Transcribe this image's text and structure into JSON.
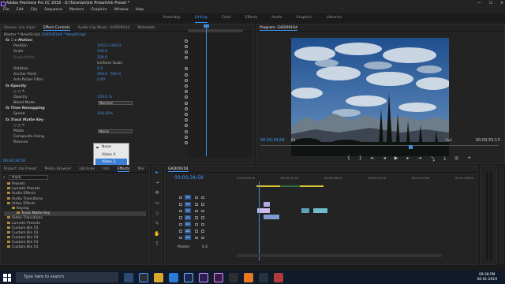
{
  "title": "Adobe Premiere Pro CC 2018 - G:\\Tutorials\\Ink PresetUnk Preset *",
  "window_controls": [
    "—",
    "☐",
    "✕"
  ],
  "menu": [
    "File",
    "Edit",
    "Clip",
    "Sequence",
    "Markers",
    "Graphics",
    "Window",
    "Help"
  ],
  "workspaces": [
    "Assembly",
    "Editing",
    "Color",
    "Effects",
    "Audio",
    "Graphics",
    "Libraries"
  ],
  "active_workspace": "Editing",
  "effect_controls": {
    "tabs": [
      "Source: (no clips)",
      "Effect Controls",
      "Audio Clip Mixer: GADO9104",
      "Metadata"
    ],
    "master": "Master * New/Script",
    "sequence": "GADO9104 * New/Script",
    "ruler_start": "00:34:00",
    "ruler_end": "00:34:58",
    "timecode": "00;00;34;58",
    "rows": [
      {
        "label": "fx  ☐ ▸  Motion",
        "type": "fx",
        "indent": 4
      },
      {
        "label": "Position",
        "v1": "1052.0",
        "v2": "360.0",
        "indent": 14
      },
      {
        "label": "Scale",
        "v1": "100.0",
        "indent": 14
      },
      {
        "label": "Scale Width",
        "v1": "100.0",
        "indent": 14,
        "dim": true
      },
      {
        "label": "",
        "check": "Uniform Scale",
        "indent": 14
      },
      {
        "label": "Rotation",
        "v1": "0.0",
        "indent": 14
      },
      {
        "label": "Anchor Point",
        "v1": "960.0",
        "v2": "540.0",
        "indent": 14
      },
      {
        "label": "Anti-flicker Filter",
        "v1": "0.00",
        "indent": 14
      },
      {
        "label": "fx  Opacity",
        "type": "fx",
        "indent": 4
      },
      {
        "label": "○ ◻ ✎",
        "indent": 14
      },
      {
        "label": "Opacity",
        "v1": "100.0 %",
        "indent": 14
      },
      {
        "label": "Blend Mode",
        "select": "Normal",
        "indent": 14
      },
      {
        "label": "fx  Time Remapping",
        "type": "fx",
        "indent": 4
      },
      {
        "label": "Speed",
        "v1": "100.00%",
        "indent": 14
      },
      {
        "label": "fx  Track Matte Key",
        "type": "fx",
        "indent": 4
      },
      {
        "label": "○ ◻ ✎",
        "indent": 14
      },
      {
        "label": "Matte",
        "select": "None",
        "indent": 14
      },
      {
        "label": "Composite Using",
        "indent": 14
      },
      {
        "label": "Reverse",
        "indent": 14
      }
    ]
  },
  "matte_dropdown": {
    "options": [
      "None",
      "Video 4",
      "Video 3"
    ],
    "checked": "None",
    "highlighted": "Video 3"
  },
  "program": {
    "title": "Program: GADO9104",
    "timecode": "00;00;34;58",
    "duration": "00;00;55;13",
    "fit": "Fit",
    "quality": "Full"
  },
  "project": {
    "tabs": [
      "Project: Ink Preset",
      "Media Browser",
      "Libraries",
      "Info",
      "Effects",
      "Mar"
    ],
    "search": "track",
    "items": [
      {
        "label": "Presets",
        "indent": 4
      },
      {
        "label": "Lumetri Presets",
        "indent": 4
      },
      {
        "label": "Audio Effects",
        "indent": 4
      },
      {
        "label": "Audio Transitions",
        "indent": 4
      },
      {
        "label": "Video Effects",
        "indent": 4
      },
      {
        "label": "Keying",
        "indent": 10
      },
      {
        "label": "Track Matte Key",
        "indent": 16,
        "highlight": true
      },
      {
        "label": "Video Transitions",
        "indent": 4
      },
      {
        "label": "Lumetri Presets",
        "indent": 4
      },
      {
        "label": "Custom Bin 01",
        "indent": 4
      },
      {
        "label": "Custom Bin 01",
        "indent": 4
      },
      {
        "label": "Custom Bin 01",
        "indent": 4
      },
      {
        "label": "Custom Bin 01",
        "indent": 4
      },
      {
        "label": "Custom Bin 01",
        "indent": 4
      }
    ]
  },
  "timeline": {
    "sequence_tab": "GADO9104",
    "timecode": "00;00;34;58",
    "ruler": [
      "00;00;16;00",
      "00;00;32;00",
      "00;00;48;00",
      "00;01;04;00",
      "00;01;20;00",
      "00;01;36;00"
    ],
    "tracks": [
      "V4",
      "V3",
      "V2",
      "V1",
      "A1",
      "A2",
      "A3"
    ],
    "master": "Master",
    "master_val": "0.0"
  },
  "tools": [
    "▸",
    "⇥",
    "✥",
    "↔",
    "◇",
    "✎",
    "✋",
    "T"
  ],
  "taskbar": {
    "search": "Type here to search",
    "time": "09:38 PM",
    "date": "06-01-2019"
  },
  "colors": {
    "accent": "#3f9bff",
    "sky": "#2c5fa0",
    "clip_video": "#9a8ac9",
    "clip_teal": "#5aa3b8"
  }
}
